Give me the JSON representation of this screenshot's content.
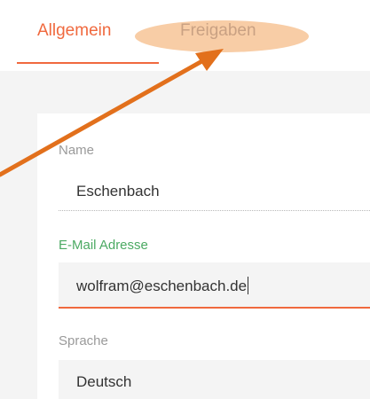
{
  "tabs": {
    "general": "Allgemein",
    "share": "Freigaben"
  },
  "form": {
    "name_label": "Name",
    "name_value": "Eschenbach",
    "email_label": "E-Mail Adresse",
    "email_value": "wolfram@eschenbach.de",
    "language_label": "Sprache",
    "language_value": "Deutsch"
  },
  "colors": {
    "accent": "#f0693e",
    "active_label": "#4caa63",
    "annotation_arrow": "#e2701c",
    "annotation_highlight": "#f7c496"
  }
}
